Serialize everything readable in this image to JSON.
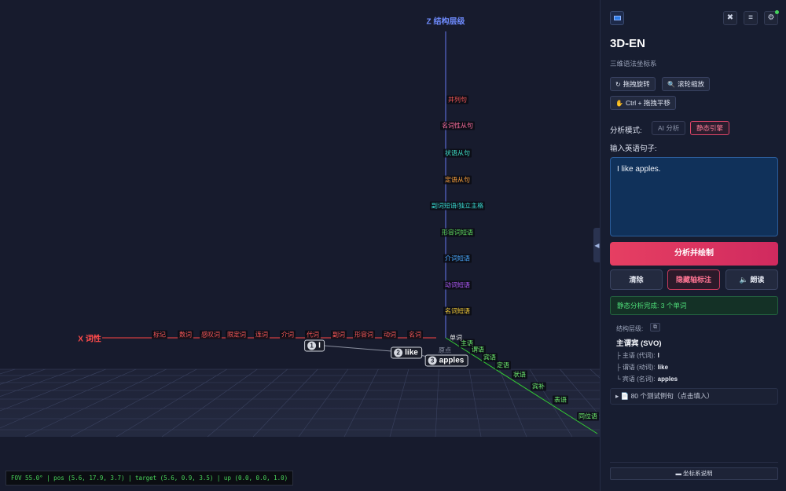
{
  "scene": {
    "z_axis_title": "Z 结构层级",
    "x_axis_title": "X 词性",
    "z_labels": [
      {
        "text": "并列句",
        "color": "#ff5a5a"
      },
      {
        "text": "名词性从句",
        "color": "#ff6fa0"
      },
      {
        "text": "状语从句",
        "color": "#3fe0c8"
      },
      {
        "text": "定语从句",
        "color": "#ffa23a"
      },
      {
        "text": "副词短语/独立主格",
        "color": "#39d9d0"
      },
      {
        "text": "形容词短语",
        "color": "#5fdc5f"
      },
      {
        "text": "介词短语",
        "color": "#4aa8ff"
      },
      {
        "text": "动词短语",
        "color": "#b45cff"
      },
      {
        "text": "名词短语",
        "color": "#ffd43a"
      }
    ],
    "x_labels": [
      "标记",
      "数词",
      "感叹词",
      "限定词",
      "连词",
      "介词",
      "代词",
      "副词",
      "形容词",
      "动词",
      "名词"
    ],
    "origin_labels": {
      "single": "单词",
      "origin": "原点"
    },
    "y_labels": [
      "主语",
      "谓语",
      "宾语",
      "定语",
      "状语",
      "宾补",
      "表语",
      "同位语"
    ],
    "words": [
      {
        "num": "1",
        "text": "I"
      },
      {
        "num": "2",
        "text": "like"
      },
      {
        "num": "3",
        "text": "apples"
      }
    ],
    "camera_status": "FOV 55.0° | pos (5.6, 17.9, 3.7) | target (5.6, 0.9, 3.5) | up (0.0, 0.0, 1.0)"
  },
  "panel": {
    "title": "3D-EN",
    "subtitle": "三维语法坐标系",
    "hints": [
      {
        "icon": "↻",
        "label": "拖拽旋转"
      },
      {
        "icon": "🔍",
        "label": "滚轮缩放"
      },
      {
        "icon": "✋",
        "label": "Ctrl + 拖拽平移"
      }
    ],
    "mode_label": "分析模式:",
    "mode_ai": "AI 分析",
    "mode_static": "静态引擎",
    "input_label": "输入英语句子:",
    "input_value": "I like apples.",
    "analyze_button": "分析并绘制",
    "clear_button": "清除",
    "hide_button": "隐藏轴标注",
    "read_button": "🔈 朗读",
    "status": "静态分析完成: 3 个单词",
    "structure_label": "结构层级:",
    "structure_name": "主谓宾 (SVO)",
    "structure_rows": [
      {
        "role": "├ 主语 (代词):",
        "word": "I"
      },
      {
        "role": "├ 谓语 (动词):",
        "word": "like"
      },
      {
        "role": "└ 宾语 (名词):",
        "word": "apples"
      }
    ],
    "examples": "▸ 📄 80 个测试例句（点击填入）",
    "coord_help": "▬ 坐标系说明"
  },
  "colors": {
    "accent": "#e63f62",
    "x_axis": "#ff4444",
    "y_axis": "#33cc33",
    "z_axis": "#6677ee",
    "success": "#4fe07a"
  }
}
